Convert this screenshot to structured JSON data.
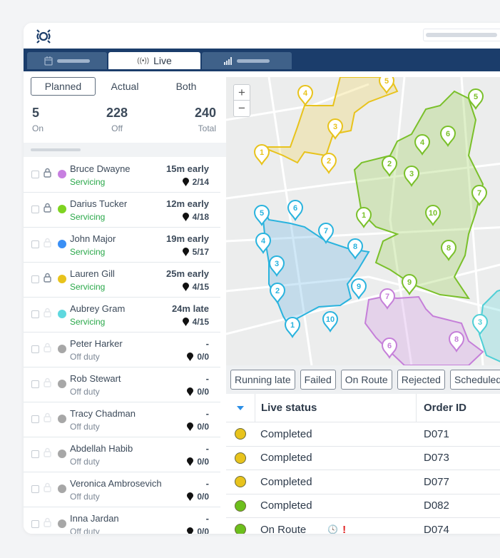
{
  "tabs": [
    {
      "label": "",
      "icon": "calendar-icon"
    },
    {
      "label": "Live",
      "icon": "broadcast-icon"
    },
    {
      "label": "",
      "icon": "bar-chart-icon"
    }
  ],
  "view_toggle": {
    "options": [
      "Planned",
      "Actual",
      "Both"
    ],
    "selected": "Planned"
  },
  "stats": [
    {
      "value": "5",
      "label": "On"
    },
    {
      "value": "228",
      "label": "Off"
    },
    {
      "value": "240",
      "label": "Total"
    }
  ],
  "drivers": [
    {
      "name": "Bruce Dwayne",
      "status": "Servicing",
      "time": "15m early",
      "stops": "2/14",
      "color": "#c77fe0",
      "lock": "locked"
    },
    {
      "name": "Darius Tucker",
      "status": "Servicing",
      "time": "12m early",
      "stops": "4/18",
      "color": "#7ed321",
      "lock": "locked"
    },
    {
      "name": "John Major",
      "status": "Servicing",
      "time": "19m early",
      "stops": "5/17",
      "color": "#3a8ff5",
      "lock": "faint"
    },
    {
      "name": "Lauren Gill",
      "status": "Servicing",
      "time": "25m early",
      "stops": "4/15",
      "color": "#e8c31c",
      "lock": "locked"
    },
    {
      "name": "Aubrey Gram",
      "status": "Servicing",
      "time": "24m late",
      "stops": "4/15",
      "color": "#5fd8df",
      "lock": "faint"
    },
    {
      "name": "Peter Harker",
      "status": "Off duty",
      "time": "-",
      "stops": "0/0",
      "color": "#a7a7a7",
      "lock": "faint"
    },
    {
      "name": "Rob Stewart",
      "status": "Off duty",
      "time": "-",
      "stops": "0/0",
      "color": "#a7a7a7",
      "lock": "faint"
    },
    {
      "name": "Tracy Chadman",
      "status": "Off duty",
      "time": "-",
      "stops": "0/0",
      "color": "#a7a7a7",
      "lock": "faint"
    },
    {
      "name": "Abdellah Habib",
      "status": "Off duty",
      "time": "-",
      "stops": "0/0",
      "color": "#a7a7a7",
      "lock": "faint"
    },
    {
      "name": "Veronica Ambrosevich",
      "status": "Off duty",
      "time": "-",
      "stops": "0/0",
      "color": "#a7a7a7",
      "lock": "faint"
    },
    {
      "name": "Inna Jardan",
      "status": "Off duty",
      "time": "-",
      "stops": "0/0",
      "color": "#a7a7a7",
      "lock": "faint"
    }
  ],
  "status_colors": {
    "Servicing": "#2aa84a",
    "Off duty": "#7d8896"
  },
  "map": {
    "zoom_in": "+",
    "zoom_out": "−",
    "routes": [
      {
        "color": "#e8c31c",
        "pins": [
          "5",
          "4",
          "3",
          "2",
          "1"
        ]
      },
      {
        "color": "#7ac02a",
        "pins": [
          "5",
          "6",
          "4",
          "2",
          "3",
          "7",
          "1",
          "10",
          "8",
          "9"
        ]
      },
      {
        "color": "#29b3de",
        "pins": [
          "5",
          "6",
          "7",
          "4",
          "8",
          "3",
          "2",
          "9",
          "10",
          "1"
        ]
      },
      {
        "color": "#c57fd9",
        "pins": [
          "7",
          "6",
          "8"
        ]
      },
      {
        "color": "#4fcfd6",
        "pins": [
          "3"
        ]
      }
    ]
  },
  "filters": [
    "Running late",
    "Failed",
    "On Route",
    "Rejected",
    "Scheduled"
  ],
  "table": {
    "headers": [
      "Live status",
      "Order ID"
    ],
    "rows": [
      {
        "status": "Completed",
        "order": "D071",
        "color": "#e8c31c",
        "flags": false
      },
      {
        "status": "Completed",
        "order": "D073",
        "color": "#e8c31c",
        "flags": false
      },
      {
        "status": "Completed",
        "order": "D077",
        "color": "#e8c31c",
        "flags": false
      },
      {
        "status": "Completed",
        "order": "D082",
        "color": "#6cbf1c",
        "flags": false
      },
      {
        "status": "On Route",
        "order": "D074",
        "color": "#6cbf1c",
        "flags": true
      }
    ]
  }
}
